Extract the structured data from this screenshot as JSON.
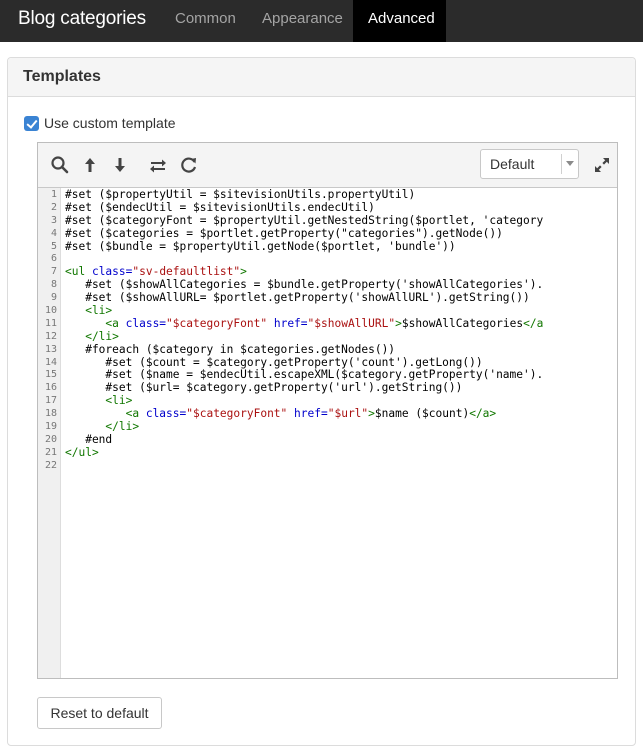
{
  "header": {
    "title": "Blog categories",
    "tabs": [
      {
        "label": "Common",
        "active": false
      },
      {
        "label": "Appearance",
        "active": false
      },
      {
        "label": "Advanced",
        "active": true
      }
    ]
  },
  "panel": {
    "title": "Templates",
    "custom_template": {
      "label": "Use custom template",
      "checked": true
    },
    "editor": {
      "toolbar_icons": [
        "search-icon",
        "arrow-up-icon",
        "arrow-down-icon",
        "replace-icon",
        "refresh-icon"
      ],
      "theme": {
        "selected": "Default"
      },
      "expand_icon": "expand-icon",
      "line_numbers": [
        "1",
        "2",
        "3",
        "4",
        "5",
        "6",
        "7",
        "8",
        "9",
        "10",
        "11",
        "12",
        "13",
        "14",
        "15",
        "16",
        "17",
        "18",
        "19",
        "20",
        "21",
        "22"
      ],
      "lines": [
        [
          {
            "t": "#set ($propertyUtil = $sitevisionUtils.propertyUtil)",
            "c": "plain"
          }
        ],
        [
          {
            "t": "#set ($endecUtil = $sitevisionUtils.endecUtil)",
            "c": "plain"
          }
        ],
        [
          {
            "t": "#set ($categoryFont = $propertyUtil.getNestedString($portlet, 'category",
            "c": "plain"
          }
        ],
        [
          {
            "t": "#set ($categories = $portlet.getProperty(\"categories\").getNode())",
            "c": "plain"
          }
        ],
        [
          {
            "t": "#set ($bundle = $propertyUtil.getNode($portlet, 'bundle'))",
            "c": "plain"
          }
        ],
        [],
        [
          {
            "t": "<ul ",
            "c": "tag"
          },
          {
            "t": "class=",
            "c": "attr"
          },
          {
            "t": "\"sv-defaultlist\"",
            "c": "str"
          },
          {
            "t": ">",
            "c": "tag"
          }
        ],
        [
          {
            "t": "   #set ($showAllCategories = $bundle.getProperty('showAllCategories').",
            "c": "plain"
          }
        ],
        [
          {
            "t": "   #set ($showAllURL= $portlet.getProperty('showAllURL').getString())",
            "c": "plain"
          }
        ],
        [
          {
            "t": "   <li>",
            "c": "tag"
          }
        ],
        [
          {
            "t": "      <a ",
            "c": "tag"
          },
          {
            "t": "class=",
            "c": "attr"
          },
          {
            "t": "\"$categoryFont\"",
            "c": "str"
          },
          {
            "t": " ",
            "c": "plain"
          },
          {
            "t": "href=",
            "c": "attr"
          },
          {
            "t": "\"$showAllURL\"",
            "c": "str"
          },
          {
            "t": ">",
            "c": "tag"
          },
          {
            "t": "$showAllCategories",
            "c": "plain"
          },
          {
            "t": "</a",
            "c": "tag"
          }
        ],
        [
          {
            "t": "   </li>",
            "c": "tag"
          }
        ],
        [
          {
            "t": "   #foreach ($category in $categories.getNodes())",
            "c": "plain"
          }
        ],
        [
          {
            "t": "      #set ($count = $category.getProperty('count').getLong())",
            "c": "plain"
          }
        ],
        [
          {
            "t": "      #set ($name = $endecUtil.escapeXML($category.getProperty('name').",
            "c": "plain"
          }
        ],
        [
          {
            "t": "      #set ($url= $category.getProperty('url').getString())",
            "c": "plain"
          }
        ],
        [
          {
            "t": "      <li>",
            "c": "tag"
          }
        ],
        [
          {
            "t": "         <a ",
            "c": "tag"
          },
          {
            "t": "class=",
            "c": "attr"
          },
          {
            "t": "\"$categoryFont\"",
            "c": "str"
          },
          {
            "t": " ",
            "c": "plain"
          },
          {
            "t": "href=",
            "c": "attr"
          },
          {
            "t": "\"$url\"",
            "c": "str"
          },
          {
            "t": ">",
            "c": "tag"
          },
          {
            "t": "$name ($count)",
            "c": "plain"
          },
          {
            "t": "</a>",
            "c": "tag"
          }
        ],
        [
          {
            "t": "      </li>",
            "c": "tag"
          }
        ],
        [
          {
            "t": "   #end",
            "c": "plain"
          }
        ],
        [
          {
            "t": "</ul>",
            "c": "tag"
          }
        ],
        []
      ]
    },
    "reset_button": "Reset to default"
  }
}
